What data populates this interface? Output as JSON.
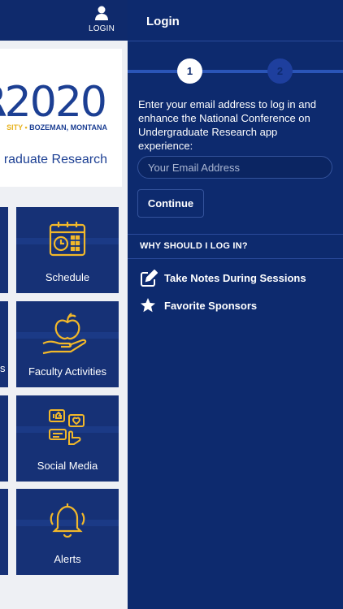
{
  "app": {
    "login_tab_label": "LOGIN",
    "banner": {
      "logo_text": "UR",
      "logo_year": "2020",
      "location_prefix": "SITY",
      "location": "BOZEMAN, MONTANA",
      "tagline": "raduate Research"
    },
    "tiles": [
      {
        "label": "Schedule",
        "icon": "calendar-clock-icon"
      },
      {
        "label": "Faculty Activities",
        "icon": "hand-apple-icon"
      },
      {
        "label": "Social Media",
        "icon": "social-media-icon"
      },
      {
        "label": "Alerts",
        "icon": "bell-icon"
      }
    ],
    "left_edge_partial_label": "s"
  },
  "login_panel": {
    "title": "Login",
    "steps": [
      "1",
      "2"
    ],
    "active_step": 1,
    "intro": "Enter your email address to log in and enhance the National Conference on Undergraduate Research app experience:",
    "email_placeholder": "Your Email Address",
    "email_value": "",
    "continue_label": "Continue",
    "why_heading": "WHY SHOULD I LOG IN?",
    "benefits": [
      {
        "label": "Take Notes During Sessions",
        "icon": "edit-icon"
      },
      {
        "label": "Favorite Sponsors",
        "icon": "star-icon"
      }
    ]
  },
  "colors": {
    "panel_bg": "#0d2a6e",
    "tile_bg": "#163176",
    "accent_gold": "#e8b320",
    "brand_blue": "#1c3f93"
  }
}
